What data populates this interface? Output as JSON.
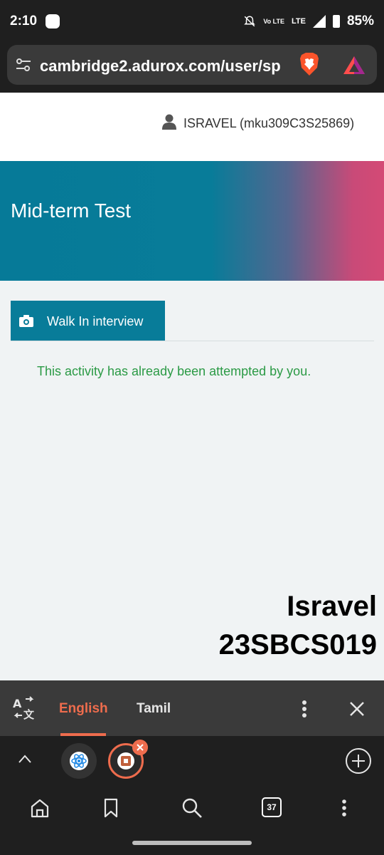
{
  "status_bar": {
    "time": "2:10",
    "volte": "Vo LTE",
    "network": "LTE",
    "battery": "85%"
  },
  "browser": {
    "url": "cambridge2.adurox.com/user/sp",
    "accent_color": "#ee6c4d"
  },
  "page": {
    "user_label": "ISRAVEL (mku309C3S25869)",
    "hero_title": "Mid-term Test",
    "tab_label": "Walk In interview",
    "message": "This activity has already been attempted by you.",
    "colors": {
      "teal": "#087c99",
      "pink": "#d44a75",
      "success": "#2b9a45"
    }
  },
  "watermark": {
    "line1": "Isravel",
    "line2": "23SBCS019"
  },
  "translate_bar": {
    "selected_language": "English",
    "other_language": "Tamil"
  },
  "tab_strip": {
    "tabs": [
      {
        "icon": "react-favicon"
      },
      {
        "icon": "brave-favicon",
        "active": true
      }
    ]
  },
  "bottom_nav": {
    "tab_count": "37"
  }
}
